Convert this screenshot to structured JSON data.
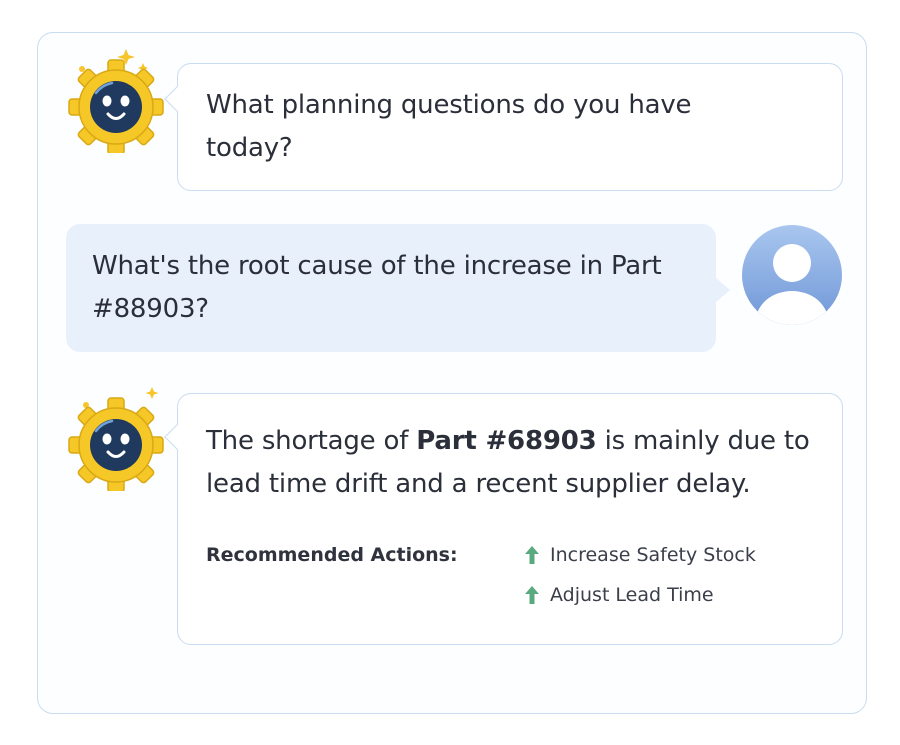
{
  "messages": [
    {
      "role": "bot",
      "avatar_icon": "robot-gear-icon",
      "text": "What planning questions do you have today?"
    },
    {
      "role": "user",
      "avatar_icon": "user-avatar-icon",
      "text": "What's the root cause of the increase in Part #88903?"
    },
    {
      "role": "bot",
      "avatar_icon": "robot-gear-icon",
      "text_pre": "The shortage of ",
      "text_bold": "Part #68903",
      "text_post": " is mainly due to lead time drift and a recent supplier delay.",
      "recommended_label": "Recommended Actions:",
      "actions": [
        {
          "icon": "up-arrow-icon",
          "label": "Increase Safety Stock"
        },
        {
          "icon": "up-arrow-icon",
          "label": "Adjust Lead Time"
        }
      ]
    }
  ],
  "colors": {
    "border": "#c9dcf0",
    "user_bubble": "#e8f0fb",
    "accent_green": "#5aa97f",
    "gear_yellow": "#f5c828",
    "robot_face": "#1f3a5e"
  }
}
